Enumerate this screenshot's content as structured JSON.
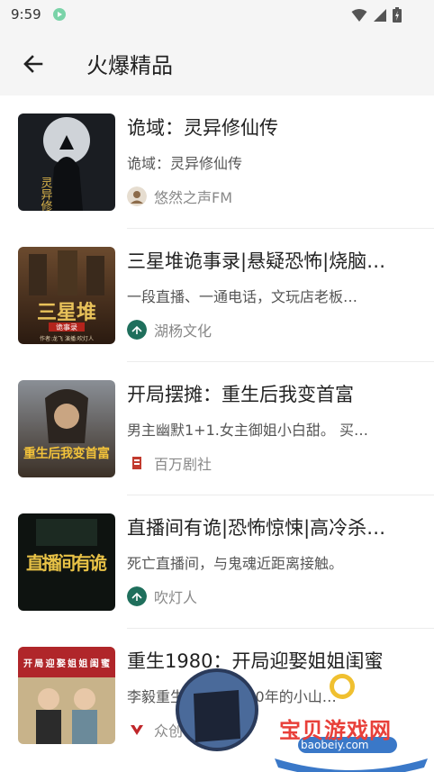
{
  "status_bar": {
    "time": "9:59"
  },
  "header": {
    "title": "火爆精品"
  },
  "items": [
    {
      "title": "诡域：灵异修仙传",
      "description": "诡域：灵异修仙传",
      "publisher": "悠然之声FM",
      "cover_text": "灵异修仙传"
    },
    {
      "title": "三星堆诡事录|悬疑恐怖|烧脑…",
      "description": "一段直播、一通电话，文玩店老板…",
      "publisher": "湖杨文化",
      "cover_text": "三星堆",
      "cover_subtext": "诡事录",
      "cover_credit": "作者:龙飞  演播:吹灯人"
    },
    {
      "title": "开局摆摊：重生后我变首富",
      "description": "男主幽默1+1.女主御姐小白甜。 买…",
      "publisher": "百万剧社",
      "cover_text": "重生后我变首富"
    },
    {
      "title": "直播间有诡|恐怖惊悚|高冷杀…",
      "description": "死亡直播间，与鬼魂近距离接触。",
      "publisher": "吹灯人",
      "cover_text": "直播间有诡"
    },
    {
      "title": "重生1980：开局迎娶姐姐闺蜜",
      "description": "李毅重生回到了1980年的小山…",
      "publisher": "众创",
      "cover_text": "开局迎娶姐姐闺蜜"
    }
  ],
  "watermark": {
    "name": "宝贝游戏网",
    "url": "baobeiy.com"
  },
  "colors": {
    "background": "#ffffff",
    "header_bg": "#f5f5f5",
    "accent_green": "#1f6f5c"
  }
}
